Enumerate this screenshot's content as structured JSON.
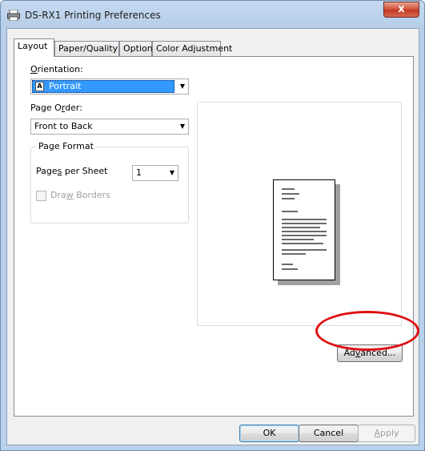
{
  "window": {
    "title": "DS-RX1 Printing Preferences",
    "close_label": "x"
  },
  "tabs": [
    {
      "label": "Layout",
      "active": true
    },
    {
      "label": "Paper/Quality",
      "active": false
    },
    {
      "label": "Option",
      "active": false
    },
    {
      "label": "Color Adjustment",
      "active": false
    }
  ],
  "layout": {
    "orientation": {
      "label_pre": "",
      "label_u": "O",
      "label_post": "rientation:",
      "value": "Portrait",
      "icon": "A"
    },
    "page_order": {
      "label_pre": "Page O",
      "label_u": "r",
      "label_post": "der:",
      "value": "Front to Back"
    },
    "page_format": {
      "legend": "Page Format",
      "pages_per_sheet": {
        "label_pre": "Page",
        "label_u": "s",
        "label_post": " per Sheet",
        "value": "1"
      },
      "draw_borders": {
        "label_pre": "Dra",
        "label_u": "w",
        "label_post": " Borders",
        "checked": false,
        "enabled": false
      }
    },
    "advanced_button": {
      "label_pre": "Ad",
      "label_u": "v",
      "label_post": "anced..."
    }
  },
  "footer": {
    "ok_label": "OK",
    "cancel_label": "Cancel",
    "apply_label_u": "A",
    "apply_label_post": "pply"
  },
  "colors": {
    "highlight_ellipse": "#e01010",
    "selection": "#3399ff"
  }
}
